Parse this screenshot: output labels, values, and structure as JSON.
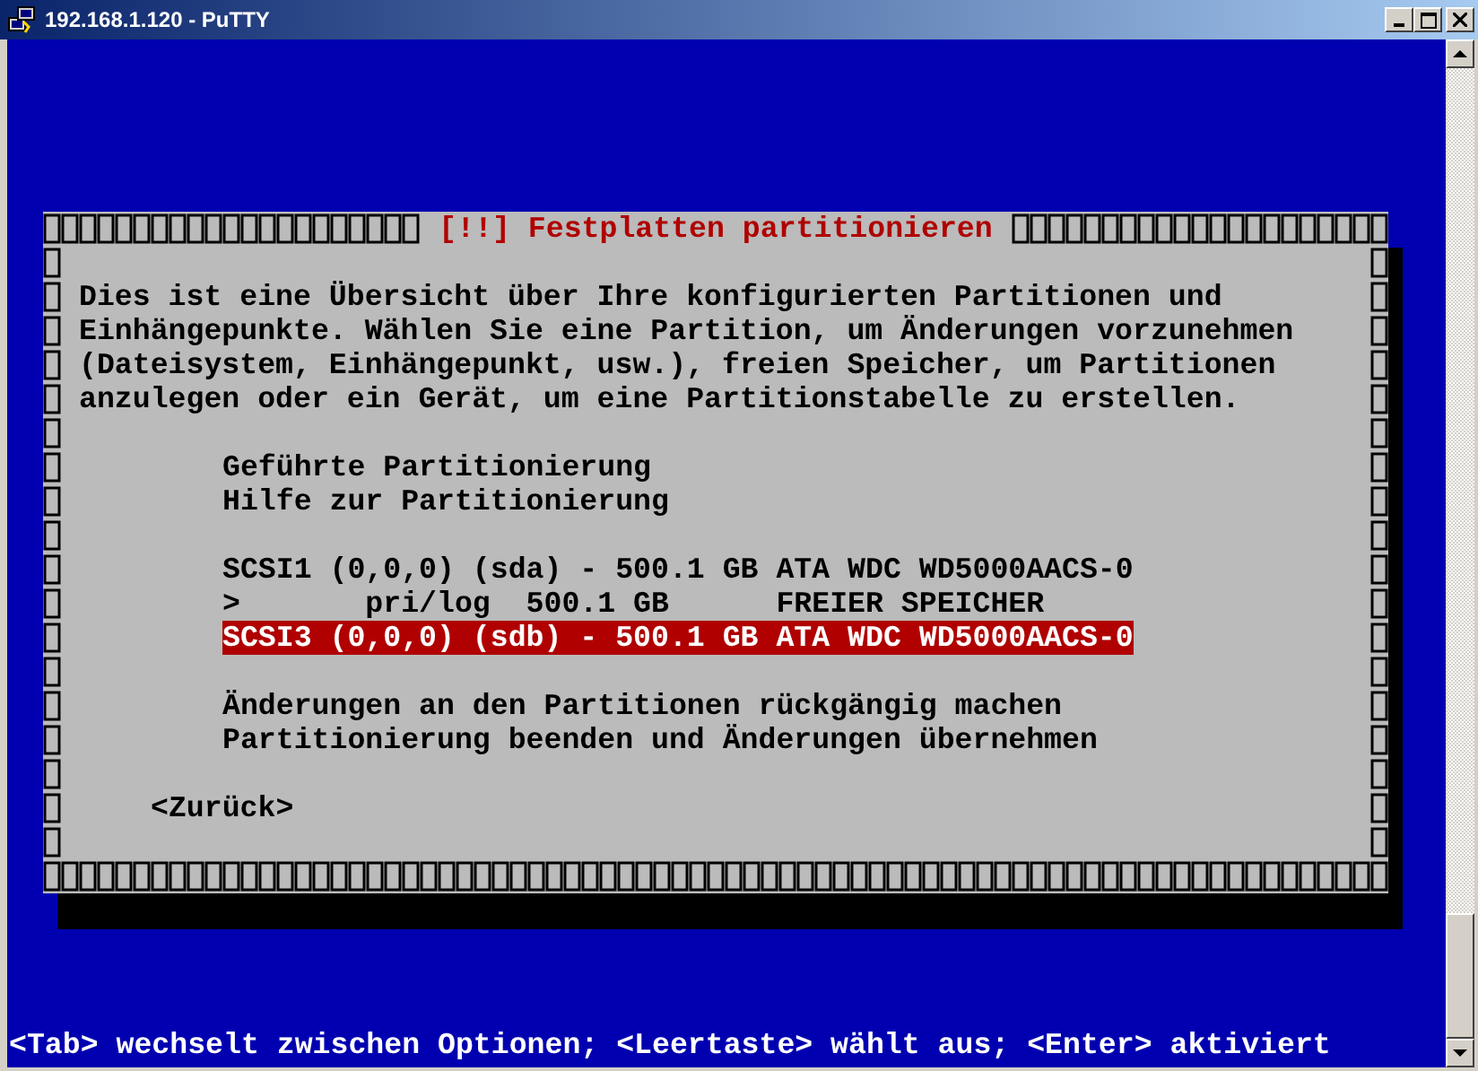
{
  "window": {
    "title": "192.168.1.120 - PuTTY"
  },
  "dialog": {
    "title": "[!!] Festplatten partitionieren",
    "description_lines": [
      "Dies ist eine Übersicht über Ihre konfigurierten Partitionen und",
      "Einhängepunkte. Wählen Sie eine Partition, um Änderungen vorzunehmen",
      "(Dateisystem, Einhängepunkt, usw.), freien Speicher, um Partitionen",
      "anzulegen oder ein Gerät, um eine Partitionstabelle zu erstellen."
    ],
    "menu_groups": [
      [
        {
          "label": "Geführte Partitionierung",
          "selected": false
        },
        {
          "label": "Hilfe zur Partitionierung",
          "selected": false
        }
      ],
      [
        {
          "label": "SCSI1 (0,0,0) (sda) - 500.1 GB ATA WDC WD5000AACS-0",
          "selected": false
        },
        {
          "label": ">       pri/log  500.1 GB      FREIER SPEICHER",
          "selected": false
        },
        {
          "label": "SCSI3 (0,0,0) (sdb) - 500.1 GB ATA WDC WD5000AACS-0",
          "selected": true
        }
      ],
      [
        {
          "label": "Änderungen an den Partitionen rückgängig machen",
          "selected": false
        },
        {
          "label": "Partitionierung beenden und Änderungen übernehmen",
          "selected": false
        }
      ]
    ],
    "back_button": "<Zurück>"
  },
  "status_line": "<Tab> wechselt zwischen Optionen; <Leertaste> wählt aus; <Enter> aktiviert"
}
